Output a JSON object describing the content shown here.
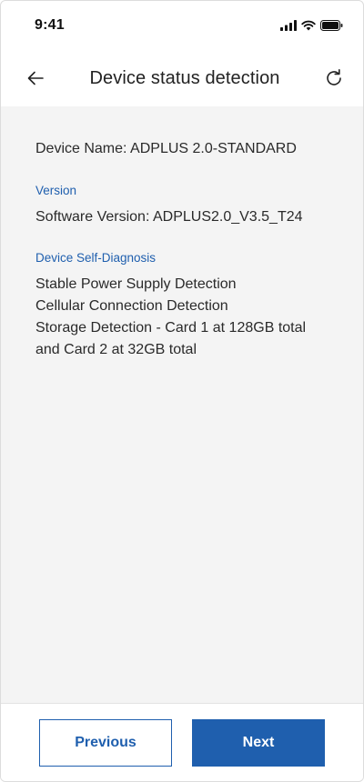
{
  "status_bar": {
    "time": "9:41",
    "icons": [
      "cellular-signal-icon",
      "wifi-icon",
      "battery-icon"
    ]
  },
  "app_bar": {
    "back_icon": "arrow-left-icon",
    "title": "Device status detection",
    "refresh_icon": "refresh-icon"
  },
  "content": {
    "device_name": "Device Name: ADPLUS 2.0-STANDARD",
    "version_section": {
      "label": "Version",
      "software_version": "Software Version: ADPLUS2.0_V3.5_T24"
    },
    "diagnosis_section": {
      "label": "Device Self-Diagnosis",
      "items": [
        "Stable Power Supply Detection",
        "Cellular Connection Detection",
        "Storage Detection - Card 1 at 128GB total and Card 2 at 32GB total"
      ]
    }
  },
  "footer": {
    "previous_label": "Previous",
    "next_label": "Next"
  },
  "colors": {
    "accent": "#1f5fae",
    "content_background": "#f4f4f4",
    "text": "#2a2a2a"
  }
}
